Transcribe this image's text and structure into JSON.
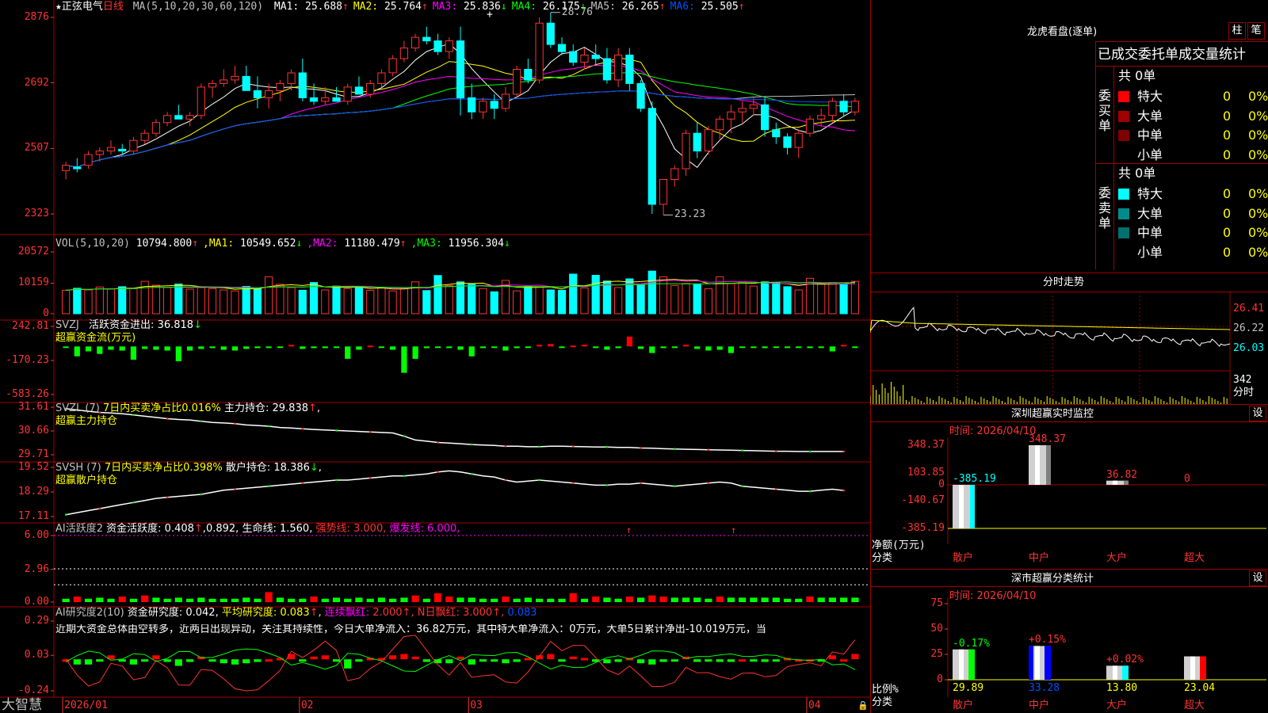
{
  "stock": {
    "star": "★",
    "name": "正弦电气",
    "period": "日线"
  },
  "price_panel": {
    "ma_header": "MA(5,10,20,30,60,120)",
    "ma": [
      {
        "label": "MA1:",
        "value": "25.688",
        "arrow": "↑",
        "color": "#ffffff"
      },
      {
        "label": "MA2:",
        "value": "25.764",
        "arrow": "↑",
        "color": "#ffff00"
      },
      {
        "label": "MA3:",
        "value": "25.836",
        "arrow": "↓",
        "color": "#ff00ff"
      },
      {
        "label": "MA4:",
        "value": "26.175",
        "arrow": "↓",
        "color": "#00ff00"
      },
      {
        "label": "MA5:",
        "value": "26.265",
        "arrow": "↑",
        "color": "#c0c0c0"
      },
      {
        "label": "MA6:",
        "value": "25.505",
        "arrow": "↑",
        "color": "#0050ff"
      }
    ],
    "y_ticks": [
      "2876",
      "2692",
      "2507",
      "2323"
    ],
    "high_label": "28.76",
    "low_label": "23.23",
    "cursor_mark": "+"
  },
  "vol_panel": {
    "header": "VOL(5,10,20)",
    "vol_value": "10794.800",
    "vol_arrow": "↑",
    "ma": [
      {
        "label": "MA1:",
        "value": "10549.652",
        "arrow": "↓",
        "color": "#ffff00"
      },
      {
        "label": "MA2:",
        "value": "11180.479",
        "arrow": "↑",
        "color": "#ff00ff"
      },
      {
        "label": "MA3:",
        "value": "11956.304",
        "arrow": "↓",
        "color": "#00ff00"
      }
    ],
    "y_ticks": [
      "20572",
      "10159",
      "0"
    ]
  },
  "svzj_panel": {
    "header": "SVZJ",
    "label": "活跃资金进出:",
    "value": "36.818",
    "arrow": "↓",
    "subtitle": "超赢资金流(万元)",
    "y_ticks": [
      "242.81",
      "-170.23",
      "-583.26"
    ]
  },
  "svzl_panel": {
    "header": "SVZL (7)",
    "text1": "7日内买卖净占比0.016%",
    "label2": "主力持仓:",
    "value2": "29.838",
    "arrow": "↑",
    "subtitle": "超赢主力持仓",
    "y_ticks": [
      "31.61",
      "30.66",
      "29.71"
    ]
  },
  "svsh_panel": {
    "header": "SVSH (7)",
    "text1": "7日内买卖净占比0.398%",
    "label2": "散户持仓:",
    "value2": "18.386",
    "arrow": "↓",
    "subtitle": "超赢散户持仓",
    "y_ticks": [
      "19.52",
      "18.29",
      "17.11"
    ]
  },
  "ai1_panel": {
    "header": "AI活跃度2",
    "label1": "资金活跃度:",
    "value1": "0.408",
    "value1b": "0.892",
    "label2": "生命线:",
    "value2": "1.560",
    "label3": "强势线:",
    "value3": "3.000",
    "label4": "爆发线:",
    "value4": "6.000",
    "y_ticks": [
      "6.00",
      "2.96",
      "0.00"
    ]
  },
  "ai2_panel": {
    "header": "AI研究度2(10)",
    "label1": "资金研究度:",
    "value1": "0.042",
    "label2": "平均研究度:",
    "value2": "0.083",
    "label3": "连续飘红:",
    "value3": "2.000",
    "label4": "N日飘红:",
    "value4": "3.000",
    "value5": "0.083",
    "comment": "近期大资金总体由空转多，近两日出现异动，关注其持续性，今日大单净流入：36.82万元，其中特大单净流入：0万元，大单5日累计净出-10.019万元，当",
    "y_ticks": [
      "0.29",
      "0.03",
      "-0.24"
    ]
  },
  "bottom_axis": {
    "brand": "大智慧",
    "dates": [
      "2026/01",
      "02",
      "03",
      "04"
    ]
  },
  "right": {
    "dragon_title": "龙虎看盘(逐单)",
    "btn_bar": "柱",
    "btn_pen": "笔",
    "stats_title": "已成交委托单成交量统计",
    "buy": {
      "side_label": "委买单",
      "total": "共 0单",
      "rows": [
        {
          "name": "特大",
          "val": "0",
          "pct": "0%",
          "color": "#ff0000"
        },
        {
          "name": "大单",
          "val": "0",
          "pct": "0%",
          "color": "#a00000"
        },
        {
          "name": "中单",
          "val": "0",
          "pct": "0%",
          "color": "#800000"
        },
        {
          "name": "小单",
          "val": "0",
          "pct": "0%",
          "color": ""
        }
      ]
    },
    "sell": {
      "side_label": "委卖单",
      "total": "共 0单",
      "rows": [
        {
          "name": "特大",
          "val": "0",
          "pct": "0%",
          "color": "#00ffff"
        },
        {
          "name": "大单",
          "val": "0",
          "pct": "0%",
          "color": "#008b8b"
        },
        {
          "name": "中单",
          "val": "0",
          "pct": "0%",
          "color": "#007070"
        },
        {
          "name": "小单",
          "val": "0",
          "pct": "0%",
          "color": ""
        }
      ]
    },
    "intraday": {
      "title": "分时走势",
      "y_ticks": [
        "26.41",
        "26.22",
        "26.03"
      ],
      "vol_tick": "342",
      "vol_unit": "分时"
    },
    "monitor": {
      "title": "深圳超赢实时监控",
      "settings": "设",
      "time": "时间: 2026/04/10",
      "y_ticks": [
        "348.37",
        "103.85",
        "0",
        "-140.67",
        "-385.19"
      ],
      "values": [
        "-385.19",
        "348.37",
        "36.82",
        "0"
      ],
      "y_unit": "净额(万元)",
      "x_unit": "分类",
      "categories": [
        "散户",
        "中户",
        "大户",
        "超大"
      ]
    },
    "classify": {
      "title": "深市超赢分类统计",
      "settings": "设",
      "time": "时间: 2026/04/10",
      "y_ticks": [
        "75",
        "50",
        "25",
        "0"
      ],
      "changes": [
        "-0.17%",
        "+0.15%",
        "+0.02%",
        ""
      ],
      "values": [
        "29.89",
        "33.28",
        "13.80",
        "23.04"
      ],
      "y_unit": "比例%",
      "x_unit": "分类",
      "categories": [
        "散户",
        "中户",
        "大户",
        "超大"
      ]
    }
  },
  "chart_data": [
    {
      "type": "candlestick",
      "title": "正弦电气 日线",
      "ylim": [
        23.23,
        28.76
      ],
      "y_ticks": [
        28.76,
        26.92,
        25.07,
        23.23
      ],
      "x_ticks": [
        "2026/01",
        "02",
        "03",
        "04"
      ],
      "ohlc": [
        [
          24.45,
          24.7,
          24.2,
          24.6
        ],
        [
          24.55,
          24.8,
          24.4,
          24.5
        ],
        [
          24.6,
          25.0,
          24.5,
          24.9
        ],
        [
          24.9,
          25.1,
          24.7,
          25.0
        ],
        [
          25.0,
          25.3,
          24.9,
          25.1
        ],
        [
          25.05,
          25.2,
          24.9,
          25.0
        ],
        [
          25.0,
          25.4,
          24.9,
          25.3
        ],
        [
          25.3,
          25.6,
          25.2,
          25.5
        ],
        [
          25.5,
          25.9,
          25.4,
          25.8
        ],
        [
          25.8,
          26.1,
          25.7,
          26.0
        ],
        [
          26.0,
          26.3,
          25.9,
          25.9
        ],
        [
          25.9,
          26.1,
          25.7,
          26.0
        ],
        [
          26.0,
          26.9,
          25.9,
          26.8
        ],
        [
          26.8,
          27.0,
          26.5,
          26.9
        ],
        [
          26.9,
          27.3,
          26.8,
          27.0
        ],
        [
          27.0,
          27.4,
          26.9,
          27.1
        ],
        [
          27.1,
          27.4,
          26.9,
          26.7
        ],
        [
          26.7,
          27.1,
          26.2,
          26.5
        ],
        [
          26.5,
          26.9,
          26.2,
          26.7
        ],
        [
          26.7,
          27.0,
          26.4,
          26.9
        ],
        [
          26.9,
          27.3,
          26.7,
          27.2
        ],
        [
          27.2,
          27.6,
          26.4,
          26.5
        ],
        [
          26.5,
          26.9,
          26.3,
          26.4
        ],
        [
          26.4,
          26.8,
          26.3,
          26.5
        ],
        [
          26.5,
          26.8,
          26.4,
          26.4
        ],
        [
          26.4,
          26.9,
          26.3,
          26.8
        ],
        [
          26.8,
          27.1,
          26.6,
          26.6
        ],
        [
          26.6,
          27.0,
          26.5,
          26.9
        ],
        [
          26.9,
          27.3,
          26.8,
          27.2
        ],
        [
          27.2,
          27.7,
          27.1,
          27.6
        ],
        [
          27.6,
          28.1,
          27.5,
          27.9
        ],
        [
          27.9,
          28.3,
          27.8,
          28.2
        ],
        [
          28.2,
          28.5,
          28.0,
          28.1
        ],
        [
          28.1,
          28.3,
          27.7,
          27.8
        ],
        [
          27.8,
          28.2,
          27.6,
          28.1
        ],
        [
          28.1,
          28.5,
          26.0,
          26.5
        ],
        [
          26.5,
          26.9,
          25.9,
          26.1
        ],
        [
          26.1,
          26.5,
          25.9,
          26.4
        ],
        [
          26.4,
          26.6,
          25.9,
          26.2
        ],
        [
          26.2,
          26.8,
          26.1,
          26.6
        ],
        [
          26.6,
          27.4,
          26.5,
          27.3
        ],
        [
          27.3,
          27.6,
          26.9,
          27.0
        ],
        [
          27.0,
          28.76,
          26.9,
          28.6
        ],
        [
          28.6,
          28.9,
          27.9,
          28.0
        ],
        [
          28.0,
          28.2,
          27.7,
          27.8
        ],
        [
          27.8,
          28.0,
          27.4,
          27.5
        ],
        [
          27.5,
          27.9,
          27.3,
          27.7
        ],
        [
          27.7,
          28.0,
          27.4,
          27.6
        ],
        [
          27.6,
          27.9,
          26.9,
          27.0
        ],
        [
          27.0,
          27.9,
          26.8,
          27.7
        ],
        [
          27.7,
          27.9,
          26.7,
          26.9
        ],
        [
          26.9,
          27.0,
          26.1,
          26.2
        ],
        [
          26.2,
          26.4,
          23.23,
          23.5
        ],
        [
          23.5,
          23.9,
          23.2,
          24.2
        ],
        [
          24.2,
          24.6,
          24.0,
          24.5
        ],
        [
          24.5,
          25.6,
          24.3,
          25.5
        ],
        [
          25.5,
          25.8,
          24.8,
          25.0
        ],
        [
          25.0,
          25.7,
          24.9,
          25.6
        ],
        [
          25.6,
          26.0,
          25.3,
          25.9
        ],
        [
          25.9,
          26.3,
          25.5,
          26.1
        ],
        [
          26.1,
          26.4,
          25.8,
          26.2
        ],
        [
          26.2,
          26.5,
          26.0,
          26.3
        ],
        [
          26.3,
          26.5,
          25.4,
          25.6
        ],
        [
          25.6,
          25.8,
          25.2,
          25.4
        ],
        [
          25.4,
          25.5,
          24.9,
          25.1
        ],
        [
          25.1,
          25.6,
          24.8,
          25.5
        ],
        [
          25.5,
          26.0,
          25.4,
          25.9
        ],
        [
          25.9,
          26.2,
          25.7,
          26.0
        ],
        [
          26.0,
          26.5,
          25.8,
          26.4
        ],
        [
          26.4,
          26.6,
          26.0,
          26.1
        ],
        [
          26.1,
          26.5,
          26.0,
          26.4
        ]
      ]
    },
    {
      "type": "bar",
      "title": "VOL(5,10,20)",
      "ylim": [
        0,
        20572
      ],
      "values": [
        7800,
        8500,
        7900,
        8900,
        8200,
        9000,
        8400,
        10800,
        9500,
        8700,
        9900,
        8200,
        8700,
        8400,
        7900,
        7600,
        9100,
        8300,
        12300,
        9800,
        8700,
        7800,
        10400,
        7900,
        9200,
        8400,
        8800,
        7800,
        8700,
        7600,
        8400,
        10600,
        7700,
        12700,
        9400,
        10600,
        9800,
        8400,
        7300,
        11100,
        7600,
        9100,
        8900,
        7900,
        7800,
        13200,
        8600,
        12800,
        10900,
        8700,
        11600,
        9600,
        14200,
        12300,
        9400,
        10100,
        9900,
        8300,
        12300,
        10000,
        10600,
        9200,
        10600,
        10300,
        9000,
        7900,
        11800,
        10000,
        10400,
        9700,
        10800
      ]
    },
    {
      "type": "bar",
      "title": "SVZJ",
      "ylim": [
        -583.26,
        242.81
      ],
      "values": [
        -5,
        -120,
        -60,
        -90,
        -40,
        -50,
        -160,
        -30,
        -40,
        -50,
        -180,
        -50,
        -30,
        -20,
        -40,
        -50,
        -30,
        -20,
        -10,
        -5,
        20,
        -30,
        -20,
        -20,
        -10,
        -150,
        -40,
        10,
        -10,
        -40,
        -320,
        -150,
        -20,
        -10,
        -20,
        -40,
        -120,
        -20,
        -10,
        -50,
        -20,
        -5,
        20,
        30,
        -10,
        10,
        20,
        -10,
        -40,
        -20,
        120,
        -30,
        -80,
        -20,
        -10,
        20,
        -30,
        -50,
        -40,
        -80,
        -10,
        -10,
        -20,
        -5,
        -10,
        -10,
        -20,
        -10,
        -60,
        20,
        -10
      ]
    },
    {
      "type": "line",
      "title": "SVZL",
      "ylim": [
        29.71,
        31.61
      ],
      "values": [
        31.55,
        31.5,
        31.45,
        31.4,
        31.38,
        31.35,
        31.3,
        31.25,
        31.2,
        31.15,
        31.12,
        31.1,
        31.05,
        31.0,
        30.98,
        30.95,
        30.9,
        30.88,
        30.85,
        30.8,
        30.78,
        30.75,
        30.72,
        30.7,
        30.68,
        30.66,
        30.64,
        30.62,
        30.6,
        30.58,
        30.45,
        30.3,
        30.25,
        30.2,
        30.18,
        30.15,
        30.12,
        30.1,
        30.08,
        30.05,
        30.05,
        30.03,
        30.03,
        30.05,
        30.05,
        30.04,
        30.03,
        30.02,
        30.02,
        30.0,
        30.0,
        29.98,
        29.97,
        29.95,
        29.94,
        29.93,
        29.92,
        29.91,
        29.9,
        29.89,
        29.88,
        29.87,
        29.86,
        29.85,
        29.85,
        29.84,
        29.84,
        29.84,
        29.84,
        29.84
      ]
    },
    {
      "type": "line",
      "title": "SVSH",
      "ylim": [
        17.11,
        19.52
      ],
      "values": [
        17.2,
        17.3,
        17.4,
        17.5,
        17.6,
        17.7,
        17.8,
        17.9,
        18.0,
        18.05,
        18.1,
        18.15,
        18.2,
        18.3,
        18.4,
        18.45,
        18.5,
        18.55,
        18.6,
        18.65,
        18.7,
        18.75,
        18.8,
        18.85,
        18.9,
        18.9,
        18.95,
        19.0,
        19.05,
        19.1,
        19.1,
        19.15,
        19.2,
        19.3,
        19.35,
        19.3,
        19.2,
        19.1,
        19.05,
        18.9,
        18.8,
        18.85,
        18.9,
        18.85,
        18.8,
        18.75,
        18.7,
        18.65,
        18.65,
        18.7,
        18.7,
        18.75,
        18.7,
        18.65,
        18.6,
        18.65,
        18.7,
        18.75,
        18.8,
        18.75,
        18.6,
        18.55,
        18.5,
        18.45,
        18.4,
        18.35,
        18.35,
        18.4,
        18.45,
        18.39
      ]
    },
    {
      "type": "bar",
      "title": "AI活跃度2",
      "ylim": [
        0,
        6.0
      ],
      "values": [
        0.3,
        0.5,
        0.3,
        0.4,
        0.3,
        0.5,
        0.3,
        0.6,
        0.4,
        0.3,
        0.4,
        0.3,
        0.4,
        0.3,
        0.3,
        0.3,
        0.4,
        0.3,
        0.9,
        0.4,
        0.3,
        0.3,
        0.5,
        0.3,
        0.4,
        0.3,
        0.4,
        0.3,
        0.4,
        0.3,
        0.4,
        0.6,
        0.3,
        0.8,
        0.5,
        0.4,
        0.4,
        0.3,
        0.3,
        0.5,
        0.3,
        0.4,
        0.3,
        0.3,
        0.3,
        0.8,
        0.3,
        0.5,
        0.4,
        0.3,
        0.5,
        0.4,
        0.6,
        0.5,
        0.4,
        0.4,
        0.4,
        0.3,
        0.5,
        0.4,
        0.4,
        0.4,
        0.4,
        0.4,
        0.3,
        0.3,
        0.5,
        0.4,
        0.4,
        0.4,
        0.4
      ]
    },
    {
      "type": "bar",
      "title": "AI研究度2(10)",
      "ylim": [
        -0.24,
        0.29
      ],
      "values": [
        0.0,
        -0.04,
        -0.04,
        -0.01,
        0.03,
        -0.01,
        -0.04,
        -0.01,
        0.03,
        -0.02,
        -0.05,
        -0.02,
        0.02,
        -0.01,
        -0.03,
        -0.04,
        -0.03,
        -0.02,
        0.0,
        0.01,
        0.04,
        -0.01,
        0.02,
        0.03,
        -0.01,
        -0.07,
        -0.01,
        0.01,
        0.01,
        0.03,
        0.04,
        0.02,
        -0.02,
        -0.03,
        -0.03,
        0.02,
        -0.04,
        -0.01,
        -0.01,
        -0.03,
        -0.02,
        0.01,
        0.03,
        0.04,
        -0.01,
        0.02,
        0.01,
        -0.02,
        -0.03,
        -0.02,
        0.01,
        -0.03,
        -0.04,
        -0.02,
        -0.01,
        0.02,
        -0.02,
        -0.01,
        -0.02,
        -0.02,
        0.0,
        -0.01,
        -0.02,
        -0.01,
        0.01,
        0.0,
        0.0,
        -0.01,
        0.03,
        0.0,
        0.04
      ]
    },
    {
      "type": "bar",
      "title": "深圳超赢实时监控",
      "categories": [
        "散户",
        "中户",
        "大户",
        "超大"
      ],
      "values": [
        -385.19,
        348.37,
        36.82,
        0
      ],
      "ylim": [
        -385.19,
        348.37
      ]
    },
    {
      "type": "bar",
      "title": "深市超赢分类统计",
      "categories": [
        "散户",
        "中户",
        "大户",
        "超大"
      ],
      "values": [
        29.89,
        33.28,
        13.8,
        23.04
      ],
      "ylim": [
        0,
        75
      ]
    }
  ]
}
